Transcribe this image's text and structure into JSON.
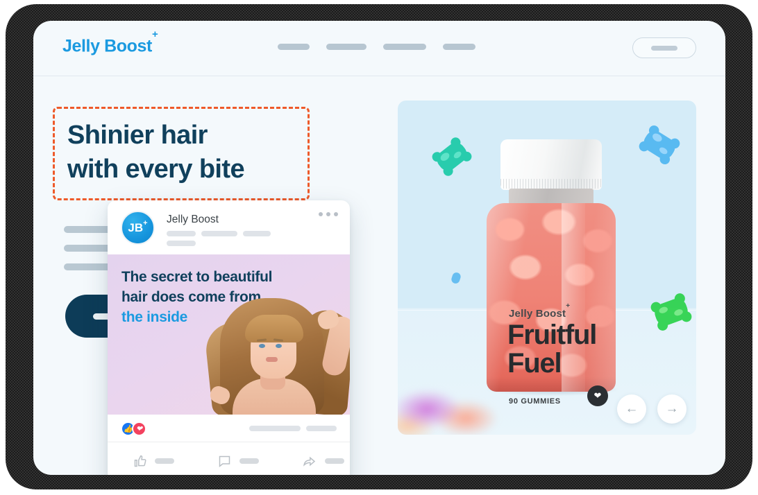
{
  "brand": {
    "name": "Jelly Boost",
    "plus": "+"
  },
  "nav": {
    "items": [
      {
        "name": "nav-item-1"
      },
      {
        "name": "nav-item-2"
      },
      {
        "name": "nav-item-3"
      },
      {
        "name": "nav-item-4"
      }
    ],
    "cta_label": ""
  },
  "hero": {
    "headline_line1": "Shinier hair",
    "headline_line2": "with every bite",
    "selection_color": "#ee5a2a",
    "headline_color": "#10405c",
    "body_placeholder_lines": [
      220,
      245,
      185
    ],
    "cta_label": ""
  },
  "social_card": {
    "avatar_initials": "JB",
    "avatar_plus": "+",
    "page_name": "Jelly Boost",
    "menu_icon": "ellipsis-icon",
    "post_copy_line1": "The secret to beautiful",
    "post_copy_line2": "hair does come from",
    "post_copy_accent": "the inside",
    "accent_color": "#1b9ae0",
    "text_color": "#10405c",
    "reactions": [
      {
        "name": "like-reaction",
        "glyph": "▲",
        "color": "#1877f2"
      },
      {
        "name": "love-reaction",
        "glyph": "♥",
        "color": "#f3425f"
      }
    ],
    "actions": [
      {
        "name": "like-action",
        "icon": "thumbs-up-icon"
      },
      {
        "name": "comment-action",
        "icon": "comment-icon"
      },
      {
        "name": "share-action",
        "icon": "share-icon"
      }
    ]
  },
  "product_card": {
    "background_color": "#d5ecf8",
    "bottle": {
      "brand": "Jelly Boost",
      "brand_plus": "+",
      "title_line1": "Fruitful",
      "title_line2": "Fuel",
      "count": "90 GUMMIES",
      "badge_icon": "heart-icon"
    },
    "gummies": [
      {
        "name": "gummy-bear-green",
        "color": "#19c9a6"
      },
      {
        "name": "gummy-bear-blue",
        "color": "#4fb6f0"
      },
      {
        "name": "gummy-bear-lime",
        "color": "#2fd24f"
      },
      {
        "name": "gummy-bear-small-blue",
        "color": "#5bb9ef"
      }
    ],
    "carousel": {
      "prev_glyph": "←",
      "next_glyph": "→"
    }
  }
}
